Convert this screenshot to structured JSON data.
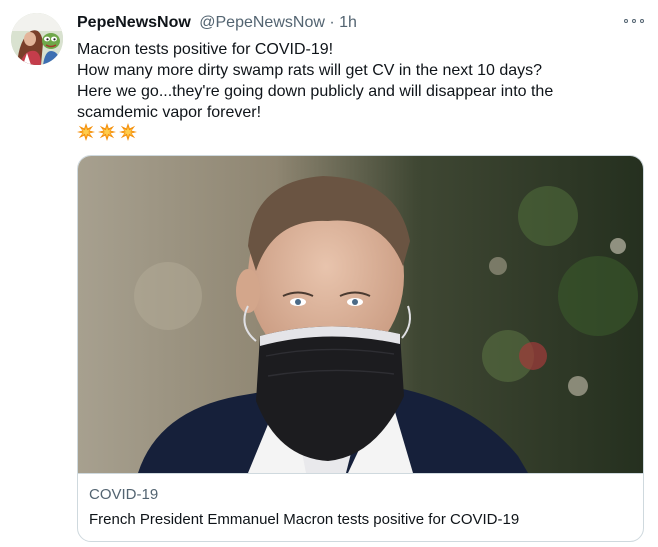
{
  "tweet": {
    "display_name": "PepeNewsNow",
    "handle": "@PepeNewsNow",
    "separator": "·",
    "time": "1h",
    "text_lines": [
      "Macron tests positive for COVID-19!",
      "How many more dirty swamp rats will get CV in the next 10 days?",
      "Here we go...they're going down publicly and will disappear into the",
      "scamdemic vapor forever!"
    ],
    "emojis": [
      "collision-icon",
      "collision-icon",
      "collision-icon"
    ]
  },
  "card": {
    "domain": "COVID-19",
    "title": "French President Emmanuel Macron tests positive for COVID-19"
  },
  "colors": {
    "text": "#0f1419",
    "secondary": "#536471",
    "border": "#cfd9de",
    "emoji": "#f4900c"
  }
}
